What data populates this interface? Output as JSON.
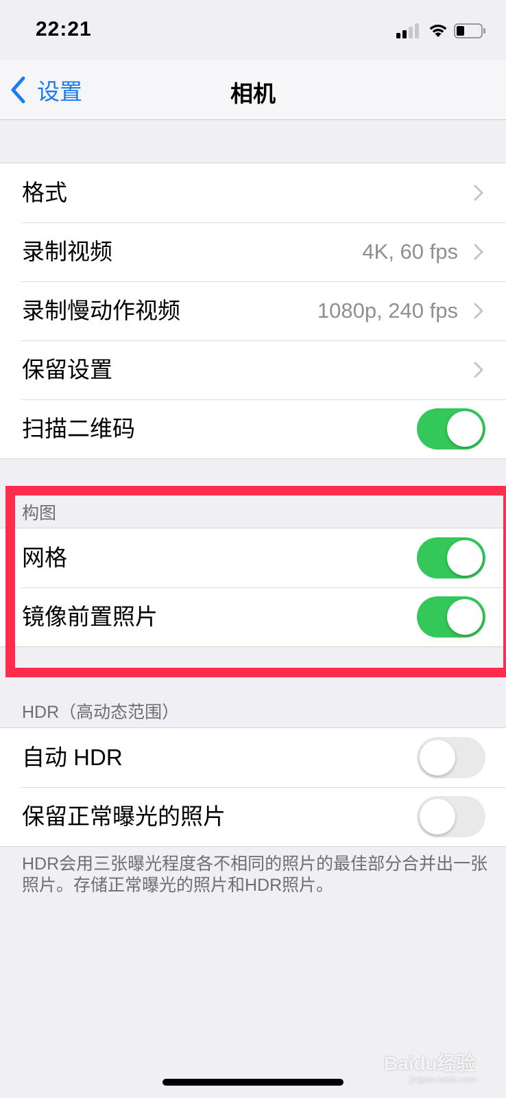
{
  "status_bar": {
    "time": "22:21"
  },
  "nav": {
    "back_label": "设置",
    "title": "相机"
  },
  "group1": {
    "rows": [
      {
        "label": "格式",
        "value": ""
      },
      {
        "label": "录制视频",
        "value": "4K, 60 fps"
      },
      {
        "label": "录制慢动作视频",
        "value": "1080p, 240 fps"
      },
      {
        "label": "保留设置",
        "value": ""
      },
      {
        "label": "扫描二维码",
        "toggle_on": true
      }
    ]
  },
  "composition": {
    "header": "构图",
    "rows": [
      {
        "label": "网格",
        "toggle_on": true
      },
      {
        "label": "镜像前置照片",
        "toggle_on": true
      }
    ]
  },
  "hdr": {
    "header": "HDR（高动态范围）",
    "rows": [
      {
        "label": "自动 HDR",
        "toggle_on": false
      },
      {
        "label": "保留正常曝光的照片",
        "toggle_on": false
      }
    ],
    "footer": "HDR会用三张曝光程度各不相同的照片的最佳部分合并出一张照片。存储正常曝光的照片和HDR照片。"
  },
  "watermark": {
    "text": "Baidu经验",
    "sub": "jingyan.baidu.com"
  },
  "colors": {
    "accent": "#1a7cf0",
    "toggle_on": "#34c759",
    "highlight": "#ff2c4b"
  }
}
